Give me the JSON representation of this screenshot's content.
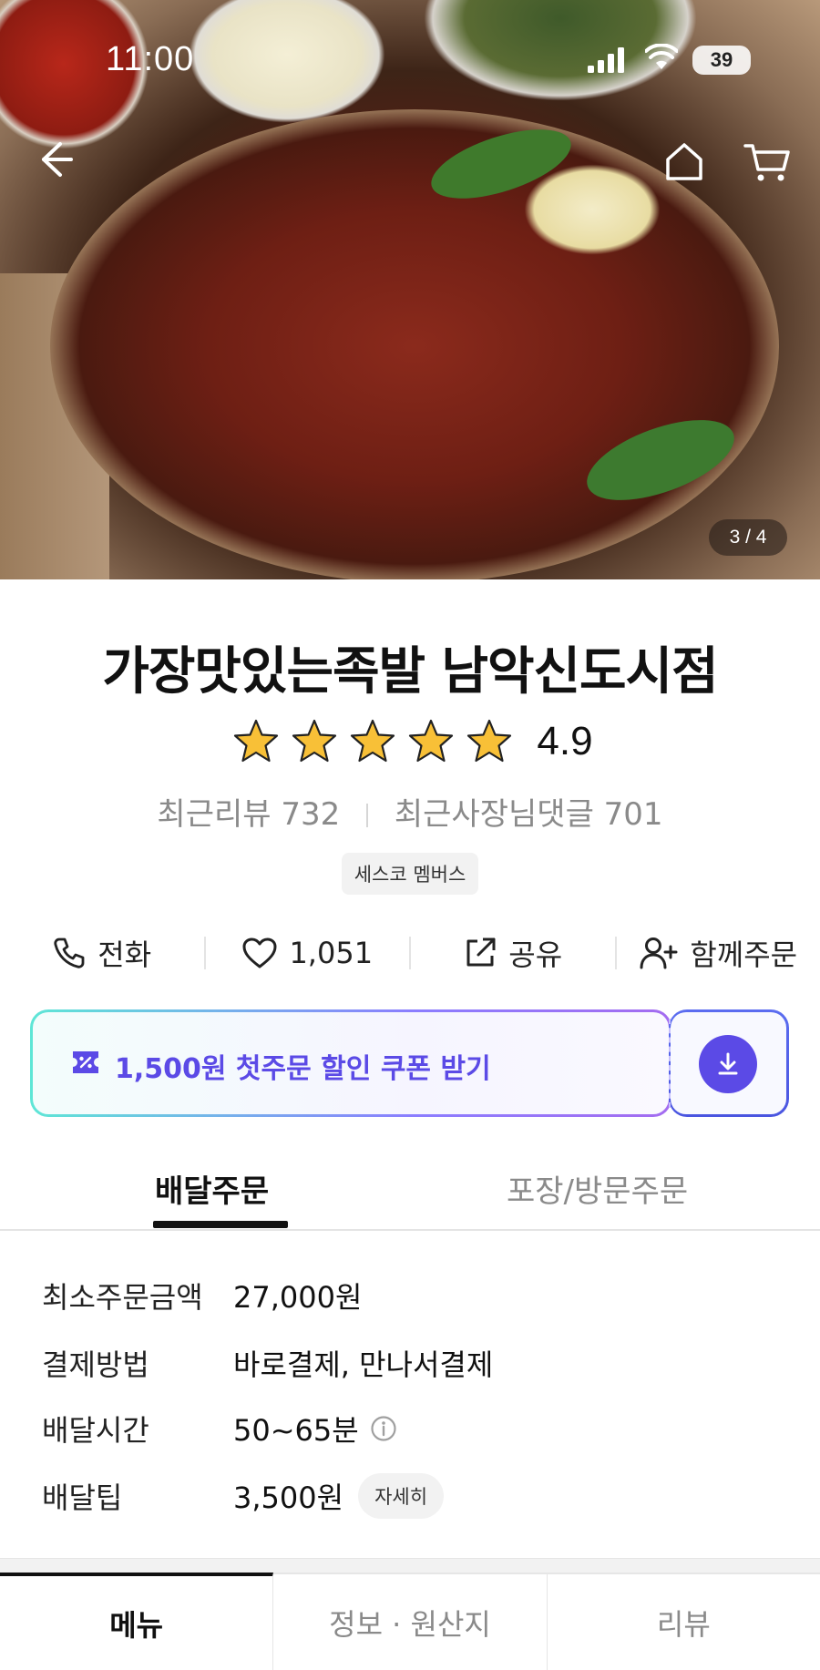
{
  "status_bar": {
    "time": "11:00",
    "battery": "39"
  },
  "hero": {
    "image_counter": "3 / 4"
  },
  "store": {
    "name": "가장맛있는족발 남악신도시점",
    "rating": "4.9",
    "star_count": 5,
    "recent_reviews_label": "최근리뷰",
    "recent_reviews_count": "732",
    "owner_replies_label": "최근사장님댓글",
    "owner_replies_count": "701",
    "badge": "세스코 멤버스"
  },
  "actions": [
    {
      "label": "전화",
      "icon": "phone-icon"
    },
    {
      "label": "1,051",
      "icon": "heart-icon"
    },
    {
      "label": "공유",
      "icon": "share-icon"
    },
    {
      "label": "함께주문",
      "icon": "add-person-icon"
    }
  ],
  "coupon": {
    "label": "1,500원 첫주문 할인 쿠폰 받기",
    "accent": "#5b4ae6"
  },
  "order_tabs": {
    "delivery": "배달주문",
    "pickup": "포장/방문주문"
  },
  "delivery_info": {
    "min_order_label": "최소주문금액",
    "min_order_value": "27,000원",
    "payment_label": "결제방법",
    "payment_value": "바로결제, 만나서결제",
    "time_label": "배달시간",
    "time_value": "50~65분",
    "tip_label": "배달팁",
    "tip_value": "3,500원",
    "tip_detail": "자세히"
  },
  "bottom_tabs": {
    "menu": "메뉴",
    "info": "정보 · 원산지",
    "review": "리뷰"
  }
}
